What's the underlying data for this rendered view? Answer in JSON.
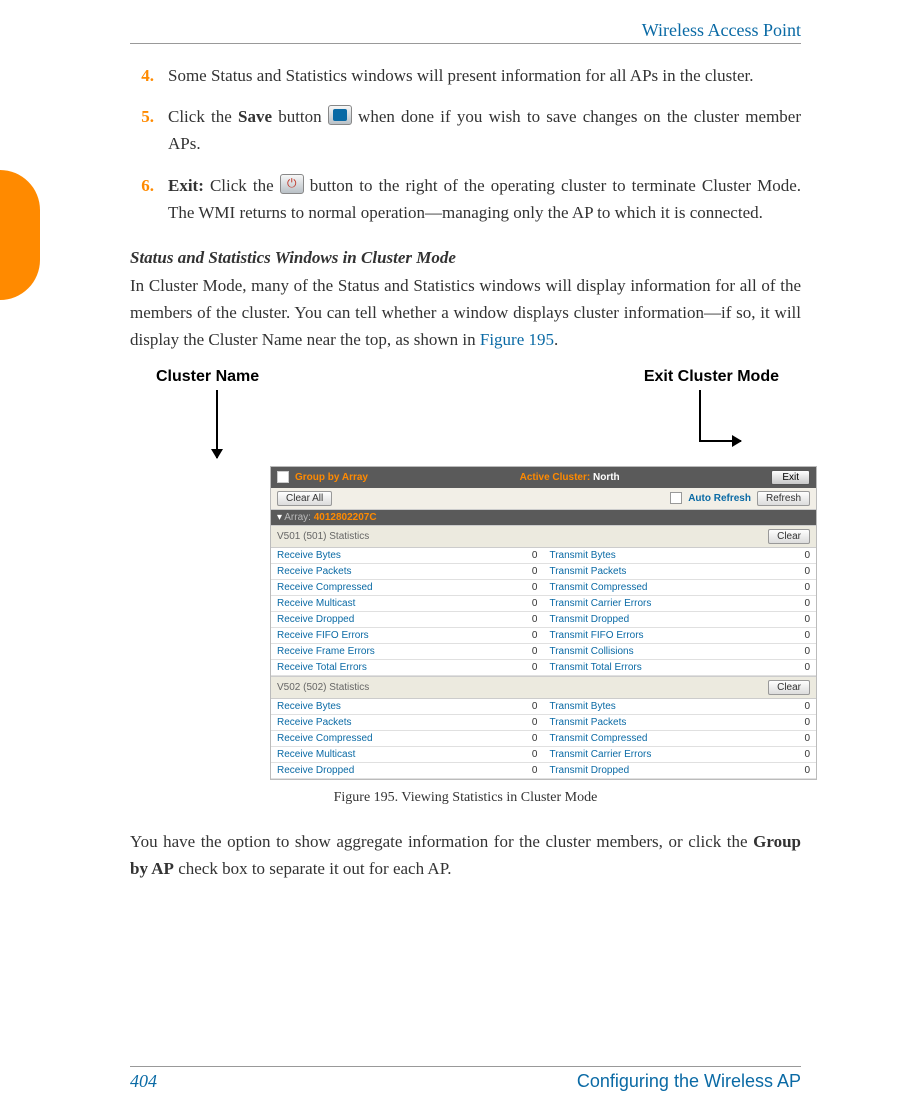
{
  "header": {
    "title": "Wireless Access Point"
  },
  "items": {
    "n4": "4.",
    "n5": "5.",
    "n6": "6.",
    "t4": "Some Status and Statistics windows will present information for all APs in the cluster.",
    "t5a": "Click the ",
    "t5b": "Save",
    "t5c": " button ",
    "t5d": " when done if you wish to save changes on the cluster member APs.",
    "t6a": "Exit:",
    "t6b": " Click the ",
    "t6c": " button to the right of the operating cluster to terminate Cluster Mode. The WMI returns to normal operation—managing only the AP to which it is connected."
  },
  "section": {
    "title": "Status and Statistics Windows in Cluster Mode",
    "para1a": "In Cluster Mode, many of the Status and Statistics windows will display information for all of the members of the cluster. You can tell whether a window displays cluster information—if so, it will display the Cluster Name near the top, as shown in ",
    "para1link": "Figure 195",
    "para1b": "."
  },
  "callouts": {
    "cluster_name": "Cluster Name",
    "exit_cluster": "Exit Cluster Mode"
  },
  "screenshot": {
    "group_by_array": "Group by Array",
    "active_cluster_label": "Active Cluster:",
    "active_cluster_name": "North",
    "exit": "Exit",
    "clear_all": "Clear All",
    "auto_refresh": "Auto Refresh",
    "refresh": "Refresh",
    "array_label": "Array:",
    "array_id": "4012802207C",
    "panel1_title": "V501 (501) Statistics",
    "panel2_title": "V502 (502) Statistics",
    "clear": "Clear",
    "rows1": [
      {
        "l": "Receive Bytes",
        "v": "0",
        "r": "Transmit Bytes",
        "rv": "0"
      },
      {
        "l": "Receive Packets",
        "v": "0",
        "r": "Transmit Packets",
        "rv": "0"
      },
      {
        "l": "Receive Compressed",
        "v": "0",
        "r": "Transmit Compressed",
        "rv": "0"
      },
      {
        "l": "Receive Multicast",
        "v": "0",
        "r": "Transmit Carrier Errors",
        "rv": "0"
      },
      {
        "l": "Receive Dropped",
        "v": "0",
        "r": "Transmit Dropped",
        "rv": "0"
      },
      {
        "l": "Receive FIFO Errors",
        "v": "0",
        "r": "Transmit FIFO Errors",
        "rv": "0"
      },
      {
        "l": "Receive Frame Errors",
        "v": "0",
        "r": "Transmit Collisions",
        "rv": "0"
      },
      {
        "l": "Receive Total Errors",
        "v": "0",
        "r": "Transmit Total Errors",
        "rv": "0"
      }
    ],
    "rows2": [
      {
        "l": "Receive Bytes",
        "v": "0",
        "r": "Transmit Bytes",
        "rv": "0"
      },
      {
        "l": "Receive Packets",
        "v": "0",
        "r": "Transmit Packets",
        "rv": "0"
      },
      {
        "l": "Receive Compressed",
        "v": "0",
        "r": "Transmit Compressed",
        "rv": "0"
      },
      {
        "l": "Receive Multicast",
        "v": "0",
        "r": "Transmit Carrier Errors",
        "rv": "0"
      },
      {
        "l": "Receive Dropped",
        "v": "0",
        "r": "Transmit Dropped",
        "rv": "0"
      }
    ]
  },
  "caption": "Figure 195. Viewing Statistics in Cluster Mode",
  "para2a": "You have the option to show aggregate information for the cluster members, or click the ",
  "para2b": "Group by AP",
  "para2c": " check box to separate it out for each AP.",
  "footer": {
    "page": "404",
    "section": "Configuring the Wireless AP"
  }
}
